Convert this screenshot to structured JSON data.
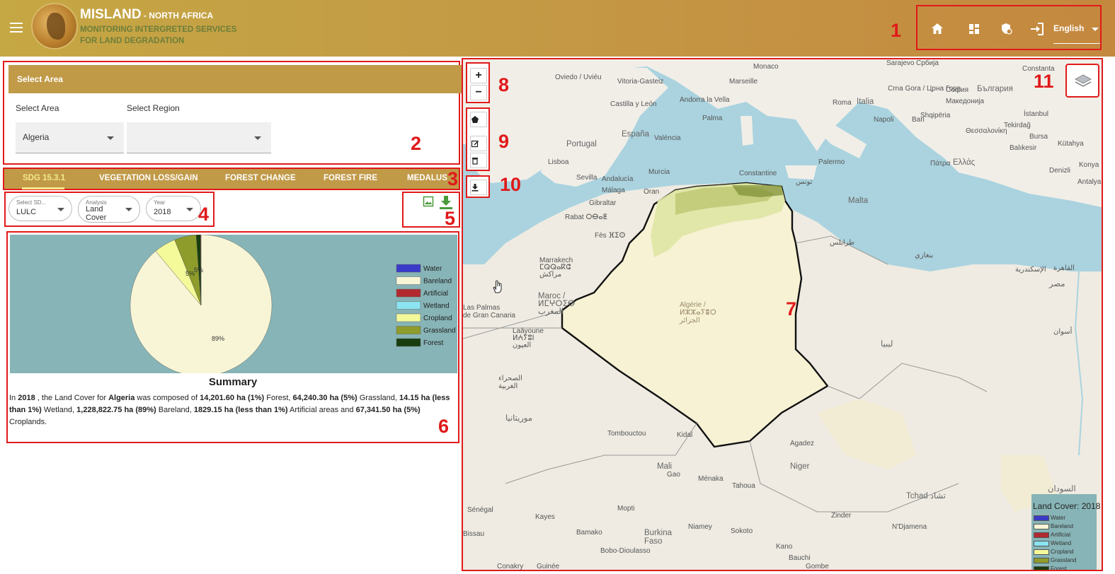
{
  "header": {
    "app_name": "MISLAND",
    "region": " - NORTH AFRICA",
    "tagline_1": "MONITORING INTERGRETED SERVICES",
    "tagline_2": "FOR LAND DEGRADATION",
    "language": "English",
    "icons": [
      "home-icon",
      "dashboard-icon",
      "security-icon",
      "login-icon"
    ]
  },
  "markers": {
    "m1": "1",
    "m2": "2",
    "m3": "3",
    "m4": "4",
    "m5": "5",
    "m6": "6",
    "m7": "7",
    "m8": "8",
    "m9": "9",
    "m10": "10",
    "m11": "11"
  },
  "area_panel": {
    "heading": "Select Area",
    "area_label": "Select Area",
    "region_label": "Select Region",
    "area_value": "Algeria",
    "region_value": ""
  },
  "tabs": [
    "SDG 15.3.1",
    "VEGETATION LOSS/GAIN",
    "FOREST CHANGE",
    "FOREST FIRE",
    "MEDALUS"
  ],
  "filters": {
    "sdg_label": "Select SD...",
    "sdg_value": "LULC",
    "analysis_label": "Analysis",
    "analysis_value_1": "Land",
    "analysis_value_2": "Cover",
    "year_label": "Year",
    "year_value": "2018"
  },
  "chart_data": {
    "type": "pie",
    "categories": [
      "Water",
      "Bareland",
      "Artificial",
      "Wetland",
      "Cropland",
      "Grassland",
      "Forest"
    ],
    "values": [
      0,
      89,
      0.1,
      0,
      5,
      5,
      1
    ],
    "data_labels": [
      "89%",
      "5%",
      "5%"
    ],
    "colors": {
      "Water": "#3a3ac8",
      "Bareland": "#f8f5d6",
      "Artificial": "#b02a30",
      "Wetland": "#8be4f0",
      "Cropland": "#f4f99a",
      "Grassland": "#8d9c2b",
      "Forest": "#173d0e"
    }
  },
  "summary": {
    "title": "Summary",
    "p1": "In ",
    "year": "2018",
    "p2": " , the Land Cover for ",
    "area": "Algeria",
    "p3": " was composed of ",
    "forest": "14,201.60 ha (1%)",
    "p4": " Forest, ",
    "grassland": "64,240.30 ha (5%)",
    "p5": " Grassland, ",
    "wetland": "14.15 ha (less than 1%)",
    "p6": " Wetland, ",
    "bareland": "1,228,822.75 ha (89%)",
    "p7": " Bareland, ",
    "artificial": "1829.15 ha (less than 1%)",
    "p8": " Artificial areas and ",
    "cropland": "67,341.50 ha (5%)",
    "p9": " Croplands."
  },
  "map": {
    "legend_title": "Land Cover: 2018",
    "legend_items": [
      "Water",
      "Bareland",
      "Artificial",
      "Wetland",
      "Cropland",
      "Grassland",
      "Forest"
    ],
    "legend_colors": [
      "#3a3ac8",
      "#f8f5d6",
      "#b02a30",
      "#8be4f0",
      "#f4f99a",
      "#8d9c2b",
      "#173d0e"
    ],
    "zoom_in": "+",
    "zoom_out": "−",
    "labels": {
      "monaco": "Monaco",
      "sarajevo": "Sarajevo",
      "srbija": "Србија",
      "constanta": "Constanta",
      "oviedo": "Oviedo / Uviéu",
      "vitoria": "Vitoria-Gasteiz",
      "marseille": "Marseille",
      "castilla": "Castilla\ny León",
      "andorra": "Andorra\nla Vella",
      "roma": "Roma",
      "italia": "Italia",
      "crna_gora": "Crna Gora /\nЦрна Гора",
      "sofia": "София",
      "bulgaria": "България",
      "macedonia": "Македонија",
      "shqiperia": "Shqipëria",
      "espana": "España",
      "portugal": "Portugal",
      "palma": "Palma",
      "valencia": "València",
      "napoli": "Napoli",
      "bari": "Bari",
      "istanbul": "İstanbul",
      "tekirdag": "Tekirdağ",
      "thessaloniki": "Θεσσαλονίκη",
      "bursa": "Bursa",
      "balikesir": "Balıkesir",
      "kutahya": "Kütahya",
      "lisboa": "Lisboa",
      "sevilla": "Sevilla",
      "andalucia": "Andalucía",
      "murcia": "Murcia",
      "palermo": "Palermo",
      "patra": "Πάτρα",
      "ellas": "Ελλάς",
      "konya": "Konya",
      "denizli": "Denizli",
      "antalya": "Antalya",
      "malaga": "Málaga",
      "gibraltar": "Gibraltar",
      "oran": "Oran",
      "constantine": "Constantine",
      "tunis": "تونس",
      "malta": "Malta",
      "rabat": "Rabat ⵔⴱⴰⵟ",
      "fes": "Fès ⴼⵉⵙ",
      "marrakech": "Marrakech\nⵎⵕⵕⴰⴽⵛ\nمراكش",
      "maroc": "Maroc /\nⵍⵎⵖⵔⵉⴱ\nالمغرب",
      "las_palmas": "Las Palmas\nde Gran Canaria",
      "algerie": "Algérie /\nⵍⵣⵣⴰⵢⴻⵔ\nالجزائر",
      "libya": "ليبيا",
      "egypt": "مصر",
      "laayoune": "Laâyoune\nⵍⵄⵢⵓⵏ\nالعيون",
      "sahara": "الصحراء\nالغربية",
      "mauritanie": "موريتانيا",
      "mali": "Mali",
      "niger": "Niger",
      "tchad": "Tchad تشاد",
      "tombouctou": "Tombouctou",
      "agadez": "Agadez",
      "senegal": "Sénégal",
      "bamako": "Bamako",
      "burkina": "Burkina\nFaso",
      "niamey": "Niamey",
      "kano": "Kano",
      "ndjamena": "N'Djamena",
      "bissau": "Bissau",
      "conakry": "Conakry",
      "guinee": "Guinée",
      "bobo": "Bobo-Dioulasso",
      "gombe": "Gombe",
      "bauchi": "Bauchi",
      "sokoto": "Sokoto",
      "kidal": "Kidal",
      "gao": "Gao",
      "mopti": "Mopti",
      "kayes": "Kayes",
      "menaka": "Ménaka",
      "tahoua": "Tahoua",
      "zinder": "Zinder",
      "sudan": "السودان",
      "aswan": "أسوان",
      "cairo": "القاهرة",
      "alexandria": "الإسكندرية",
      "benghazi": "بنغازي",
      "tripoli": "طرابلس"
    }
  }
}
